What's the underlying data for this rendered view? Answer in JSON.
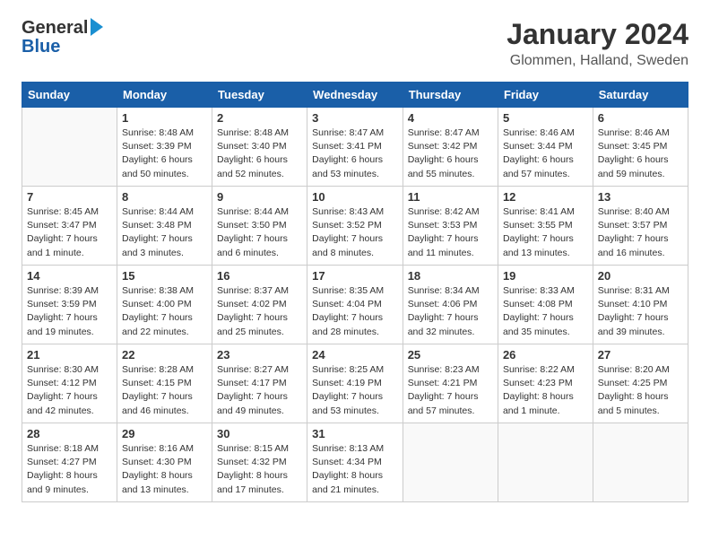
{
  "header": {
    "logo_line1": "General",
    "logo_line2": "Blue",
    "month": "January 2024",
    "location": "Glommen, Halland, Sweden"
  },
  "weekdays": [
    "Sunday",
    "Monday",
    "Tuesday",
    "Wednesday",
    "Thursday",
    "Friday",
    "Saturday"
  ],
  "weeks": [
    [
      {
        "day": "",
        "info": ""
      },
      {
        "day": "1",
        "info": "Sunrise: 8:48 AM\nSunset: 3:39 PM\nDaylight: 6 hours\nand 50 minutes."
      },
      {
        "day": "2",
        "info": "Sunrise: 8:48 AM\nSunset: 3:40 PM\nDaylight: 6 hours\nand 52 minutes."
      },
      {
        "day": "3",
        "info": "Sunrise: 8:47 AM\nSunset: 3:41 PM\nDaylight: 6 hours\nand 53 minutes."
      },
      {
        "day": "4",
        "info": "Sunrise: 8:47 AM\nSunset: 3:42 PM\nDaylight: 6 hours\nand 55 minutes."
      },
      {
        "day": "5",
        "info": "Sunrise: 8:46 AM\nSunset: 3:44 PM\nDaylight: 6 hours\nand 57 minutes."
      },
      {
        "day": "6",
        "info": "Sunrise: 8:46 AM\nSunset: 3:45 PM\nDaylight: 6 hours\nand 59 minutes."
      }
    ],
    [
      {
        "day": "7",
        "info": "Sunrise: 8:45 AM\nSunset: 3:47 PM\nDaylight: 7 hours\nand 1 minute."
      },
      {
        "day": "8",
        "info": "Sunrise: 8:44 AM\nSunset: 3:48 PM\nDaylight: 7 hours\nand 3 minutes."
      },
      {
        "day": "9",
        "info": "Sunrise: 8:44 AM\nSunset: 3:50 PM\nDaylight: 7 hours\nand 6 minutes."
      },
      {
        "day": "10",
        "info": "Sunrise: 8:43 AM\nSunset: 3:52 PM\nDaylight: 7 hours\nand 8 minutes."
      },
      {
        "day": "11",
        "info": "Sunrise: 8:42 AM\nSunset: 3:53 PM\nDaylight: 7 hours\nand 11 minutes."
      },
      {
        "day": "12",
        "info": "Sunrise: 8:41 AM\nSunset: 3:55 PM\nDaylight: 7 hours\nand 13 minutes."
      },
      {
        "day": "13",
        "info": "Sunrise: 8:40 AM\nSunset: 3:57 PM\nDaylight: 7 hours\nand 16 minutes."
      }
    ],
    [
      {
        "day": "14",
        "info": "Sunrise: 8:39 AM\nSunset: 3:59 PM\nDaylight: 7 hours\nand 19 minutes."
      },
      {
        "day": "15",
        "info": "Sunrise: 8:38 AM\nSunset: 4:00 PM\nDaylight: 7 hours\nand 22 minutes."
      },
      {
        "day": "16",
        "info": "Sunrise: 8:37 AM\nSunset: 4:02 PM\nDaylight: 7 hours\nand 25 minutes."
      },
      {
        "day": "17",
        "info": "Sunrise: 8:35 AM\nSunset: 4:04 PM\nDaylight: 7 hours\nand 28 minutes."
      },
      {
        "day": "18",
        "info": "Sunrise: 8:34 AM\nSunset: 4:06 PM\nDaylight: 7 hours\nand 32 minutes."
      },
      {
        "day": "19",
        "info": "Sunrise: 8:33 AM\nSunset: 4:08 PM\nDaylight: 7 hours\nand 35 minutes."
      },
      {
        "day": "20",
        "info": "Sunrise: 8:31 AM\nSunset: 4:10 PM\nDaylight: 7 hours\nand 39 minutes."
      }
    ],
    [
      {
        "day": "21",
        "info": "Sunrise: 8:30 AM\nSunset: 4:12 PM\nDaylight: 7 hours\nand 42 minutes."
      },
      {
        "day": "22",
        "info": "Sunrise: 8:28 AM\nSunset: 4:15 PM\nDaylight: 7 hours\nand 46 minutes."
      },
      {
        "day": "23",
        "info": "Sunrise: 8:27 AM\nSunset: 4:17 PM\nDaylight: 7 hours\nand 49 minutes."
      },
      {
        "day": "24",
        "info": "Sunrise: 8:25 AM\nSunset: 4:19 PM\nDaylight: 7 hours\nand 53 minutes."
      },
      {
        "day": "25",
        "info": "Sunrise: 8:23 AM\nSunset: 4:21 PM\nDaylight: 7 hours\nand 57 minutes."
      },
      {
        "day": "26",
        "info": "Sunrise: 8:22 AM\nSunset: 4:23 PM\nDaylight: 8 hours\nand 1 minute."
      },
      {
        "day": "27",
        "info": "Sunrise: 8:20 AM\nSunset: 4:25 PM\nDaylight: 8 hours\nand 5 minutes."
      }
    ],
    [
      {
        "day": "28",
        "info": "Sunrise: 8:18 AM\nSunset: 4:27 PM\nDaylight: 8 hours\nand 9 minutes."
      },
      {
        "day": "29",
        "info": "Sunrise: 8:16 AM\nSunset: 4:30 PM\nDaylight: 8 hours\nand 13 minutes."
      },
      {
        "day": "30",
        "info": "Sunrise: 8:15 AM\nSunset: 4:32 PM\nDaylight: 8 hours\nand 17 minutes."
      },
      {
        "day": "31",
        "info": "Sunrise: 8:13 AM\nSunset: 4:34 PM\nDaylight: 8 hours\nand 21 minutes."
      },
      {
        "day": "",
        "info": ""
      },
      {
        "day": "",
        "info": ""
      },
      {
        "day": "",
        "info": ""
      }
    ]
  ]
}
